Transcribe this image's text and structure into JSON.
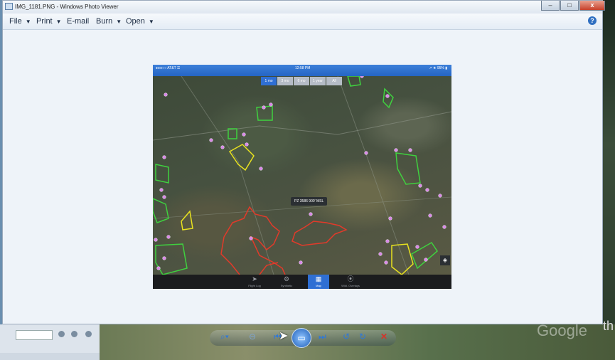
{
  "window": {
    "title": "IMG_1181.PNG - Windows Photo Viewer",
    "buttons": {
      "minimize": "–",
      "maximize": "□",
      "close": "x"
    }
  },
  "menu": {
    "items": [
      {
        "label": "File",
        "has_dropdown": true
      },
      {
        "label": "Print",
        "has_dropdown": true
      },
      {
        "label": "E-mail",
        "has_dropdown": false
      },
      {
        "label": "Burn",
        "has_dropdown": true
      },
      {
        "label": "Open",
        "has_dropdown": true
      }
    ],
    "help": "?"
  },
  "photo": {
    "status": {
      "carrier": "●●●○○ AT&T ☰",
      "time": "12:58 PM",
      "battery": "↗ ★ 95% ▮"
    },
    "time_filters": [
      {
        "label": "1 mo",
        "active": true
      },
      {
        "label": "3 mo",
        "active": false
      },
      {
        "label": "6 mo",
        "active": false
      },
      {
        "label": "1 year",
        "active": false
      },
      {
        "label": "All",
        "active": false
      }
    ],
    "tooltip": "PZ 3586 900' MSL",
    "tabs": [
      {
        "label": "Flight Log",
        "icon": "➤",
        "active": false
      },
      {
        "label": "Synthetic",
        "icon": "⚙",
        "active": false
      },
      {
        "label": "Map",
        "icon": "▦",
        "active": true
      },
      {
        "label": "Wild. Overlays",
        "icon": "⦿",
        "active": false
      }
    ],
    "layers_icon": "◈"
  },
  "background": {
    "google_watermark": "Google",
    "edge_text": "th"
  },
  "colors": {
    "accent": "#2f6fd4",
    "close": "#c6402a",
    "boundary_green": "#3fd13f",
    "boundary_yellow": "#e8e21f",
    "boundary_red": "#e23a2a",
    "pin": "#d98ae8"
  }
}
